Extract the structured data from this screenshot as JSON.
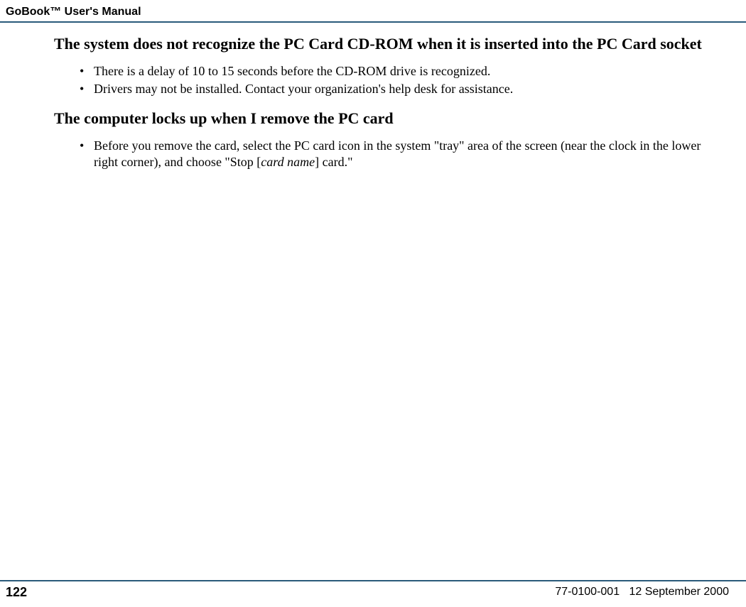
{
  "header": {
    "title": "GoBook™ User's Manual"
  },
  "sections": [
    {
      "heading": "The system does not recognize the PC Card CD-ROM when it is inserted into the PC Card socket",
      "items": [
        "There is a delay of 10 to 15 seconds before the CD-ROM drive is recognized.",
        "Drivers may not be installed. Contact your organization's help desk for assistance."
      ]
    },
    {
      "heading": "The computer locks up when I remove the PC card",
      "items_html": [
        {
          "prefix": "Before you remove the card, select the PC card icon in the system \"tray\" area of the screen (near the clock in the lower right corner), and choose \"Stop [",
          "italic": "card name",
          "suffix": "] card.\""
        }
      ]
    }
  ],
  "footer": {
    "page": "122",
    "doc_id": "77-0100-001",
    "date": "12 September 2000"
  }
}
